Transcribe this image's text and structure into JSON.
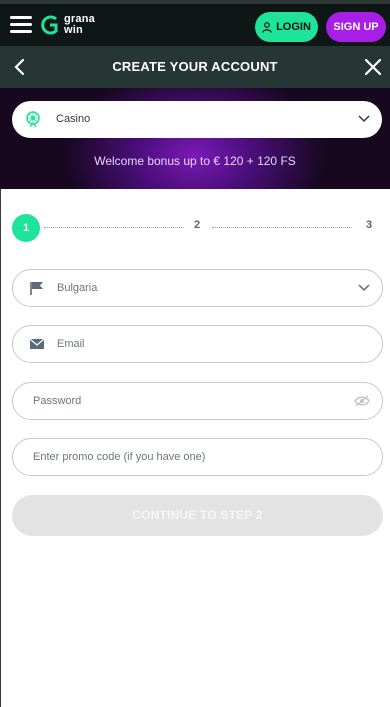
{
  "header": {
    "logo_line1": "grana",
    "logo_line2": "win",
    "login_label": "LOGIN",
    "signup_label": "SIGN UP"
  },
  "modal": {
    "title": "CREATE YOUR ACCOUNT",
    "product_select_value": "Casino",
    "bonus_text": "Welcome bonus up to € 120 + 120 FS"
  },
  "steps": {
    "step1": "1",
    "step2": "2",
    "step3": "3"
  },
  "form": {
    "country_value": "Bulgaria",
    "email_placeholder": "Email",
    "password_placeholder": "Password",
    "promo_placeholder": "Enter promo code (if you have one)",
    "continue_label": "CONTINUE TO STEP 2"
  },
  "colors": {
    "accent_green": "#1ee39a",
    "accent_purple": "#a81ee8",
    "header_bg": "#0f1716",
    "modal_bar_bg": "#263634"
  },
  "icons": [
    "menu-icon",
    "logo-icon",
    "user-icon",
    "back-icon",
    "close-icon",
    "wheel-icon",
    "chevron-down-icon",
    "flag-icon",
    "mail-icon",
    "eye-off-icon"
  ]
}
